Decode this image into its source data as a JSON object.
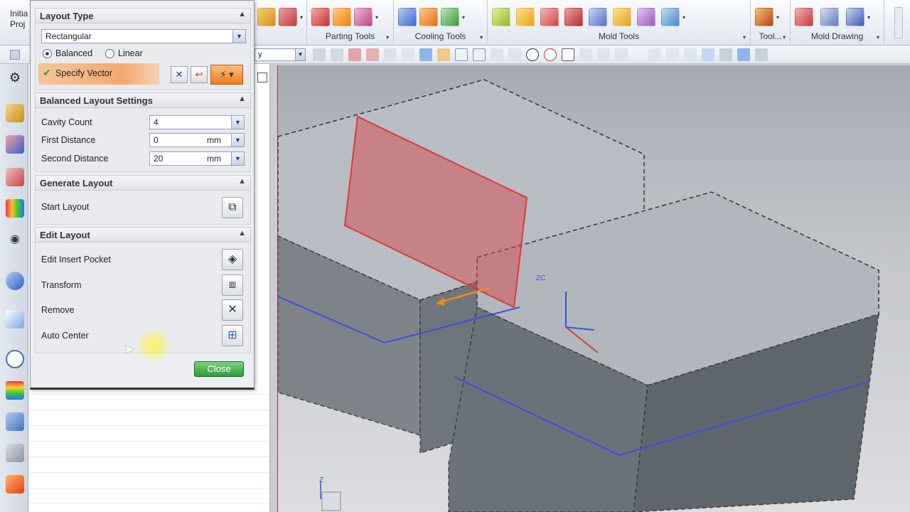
{
  "ribbon": {
    "left_labels": [
      "Initia",
      "Proj"
    ],
    "groups": [
      {
        "label": "Parting Tools"
      },
      {
        "label": "Cooling Tools"
      },
      {
        "label": "Mold Tools"
      },
      {
        "label": "Tool..."
      },
      {
        "label": "Mold Drawing"
      }
    ]
  },
  "toolbar2": {
    "filter_value": "y"
  },
  "dialog": {
    "layout_type": {
      "title": "Layout Type",
      "type_value": "Rectangular",
      "option_balanced": "Balanced",
      "option_linear": "Linear",
      "specify_vector_label": "Specify Vector"
    },
    "balanced_settings": {
      "title": "Balanced Layout Settings",
      "cavity_count_label": "Cavity Count",
      "cavity_count_value": "4",
      "first_distance_label": "First Distance",
      "first_distance_value": "0",
      "second_distance_label": "Second Distance",
      "second_distance_value": "20",
      "unit": "mm"
    },
    "generate_layout": {
      "title": "Generate Layout",
      "start_layout_label": "Start Layout"
    },
    "edit_layout": {
      "title": "Edit Layout",
      "edit_insert_pocket_label": "Edit Insert Pocket",
      "transform_label": "Transform",
      "remove_label": "Remove",
      "auto_center_label": "Auto Center"
    },
    "close_label": "Close"
  },
  "viewport": {
    "axis_label_zc": "ZC",
    "triad_label_z": "Z"
  },
  "colors": {
    "accent_orange": "#f3a96e",
    "close_green": "#2f9a3a",
    "selection_red": "#d93a3a",
    "layout_blue": "#3a4fe0"
  }
}
